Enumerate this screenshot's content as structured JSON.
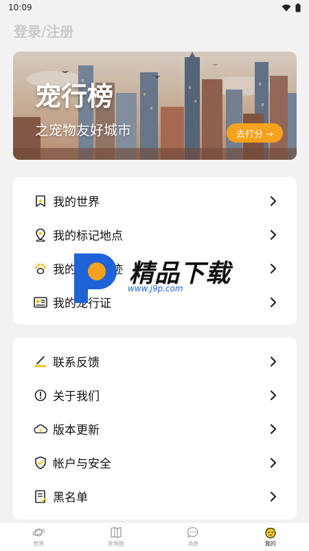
{
  "status_bar": {
    "time": "10:09"
  },
  "header": {
    "login_label": "登录/注册"
  },
  "banner": {
    "title": "宠行榜",
    "subtitle": "之宠物友好城市",
    "rate_button": "去打分 →"
  },
  "menu_group_1": [
    {
      "label": "我的世界",
      "icon": "bookmark-star-icon"
    },
    {
      "label": "我的标记地点",
      "icon": "location-pin-icon"
    },
    {
      "label": "我的遛狗足迹",
      "icon": "paw-icon"
    },
    {
      "label": "我的宠行证",
      "icon": "id-card-icon"
    }
  ],
  "menu_group_2": [
    {
      "label": "联系反馈",
      "icon": "pen-icon"
    },
    {
      "label": "关于我们",
      "icon": "info-icon"
    },
    {
      "label": "版本更新",
      "icon": "cloud-upload-icon"
    },
    {
      "label": "帐户与安全",
      "icon": "shield-icon"
    },
    {
      "label": "黑名单",
      "icon": "document-list-icon"
    }
  ],
  "watermark": {
    "brand": "精品下载",
    "url": "www.j9p.com"
  },
  "tabbar": [
    {
      "label": "世界",
      "icon": "planet-icon",
      "active": false
    },
    {
      "label": "宠地图",
      "icon": "map-icon",
      "active": false
    },
    {
      "label": "消息",
      "icon": "chat-icon",
      "active": false
    },
    {
      "label": "我的",
      "icon": "pet-face-icon",
      "active": true
    }
  ],
  "colors": {
    "accent": "#f6a21e",
    "active_tab_icon": "#f5c518",
    "background": "#f2f2f2"
  }
}
